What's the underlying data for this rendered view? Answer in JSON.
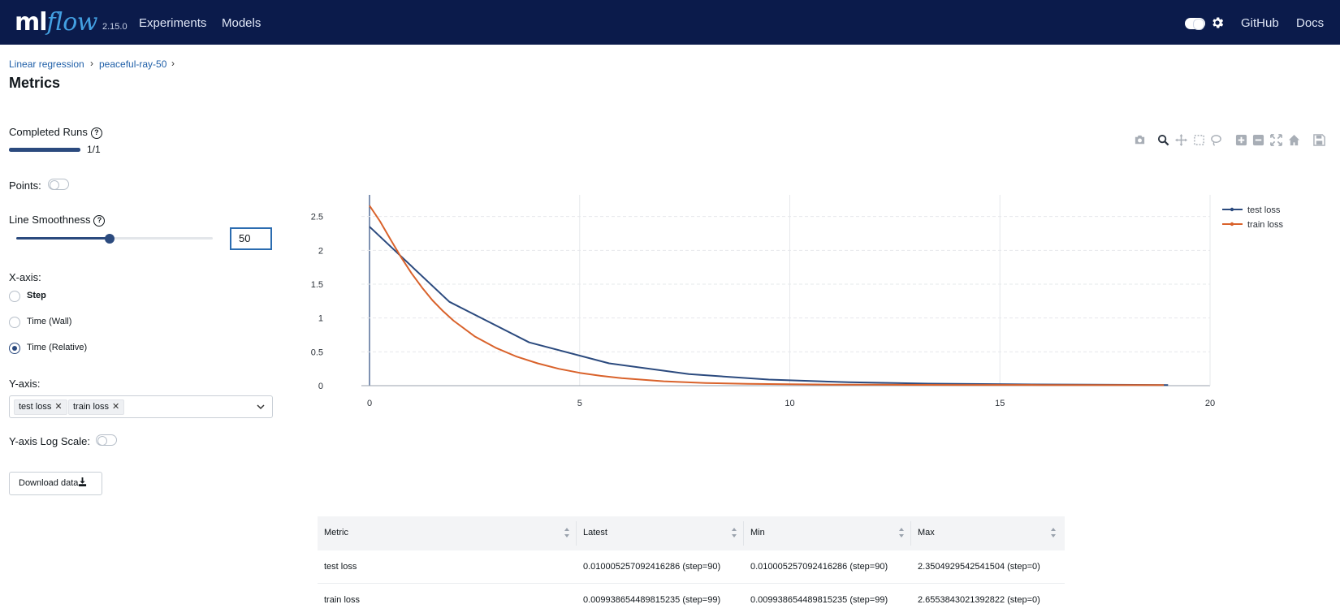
{
  "header": {
    "logo_left": "ml",
    "logo_right": "flow",
    "version": "2.15.0",
    "nav": [
      "Experiments",
      "Models"
    ],
    "right_links": [
      "GitHub",
      "Docs"
    ],
    "theme_toggle_icon": "toggle-icon",
    "settings_icon": "gear-icon"
  },
  "breadcrumb": {
    "items": [
      "Linear regression",
      "peaceful-ray-50"
    ],
    "separator": "›"
  },
  "page": {
    "title": "Metrics"
  },
  "controls": {
    "completed_runs_label": "Completed Runs",
    "completed_runs_text": "1/1",
    "completed_runs_fraction": 1.0,
    "points_label": "Points:",
    "points_on": false,
    "smoothness_label": "Line Smoothness",
    "smoothness_value": "50",
    "smoothness_level": 0.5,
    "xaxis_label": "X-axis:",
    "xaxis_options": [
      "Step",
      "Time (Wall)",
      "Time (Relative)"
    ],
    "xaxis_selected": "Time (Relative)",
    "yaxis_label": "Y-axis:",
    "yaxis_selected": [
      "test loss",
      "train loss"
    ],
    "yaxis_log_label": "Y-axis Log Scale:",
    "yaxis_log_on": false,
    "download_label": "Download data",
    "download_icon": "download-icon"
  },
  "plot_toolbar": [
    "camera-icon",
    "zoom-icon",
    "pan-icon",
    "box-select-icon",
    "lasso-icon",
    "zoom-in-icon",
    "zoom-out-icon",
    "autoscale-icon",
    "home-icon",
    "save-icon"
  ],
  "chart_data": {
    "type": "line",
    "xlim": [
      0,
      20
    ],
    "ylim": [
      0,
      2.7
    ],
    "x_ticks": [
      "0",
      "5",
      "10",
      "15",
      "20"
    ],
    "y_ticks": [
      "0",
      "0.5",
      "1",
      "1.5",
      "2",
      "2.5"
    ],
    "grid": true,
    "legend_position": "top-right",
    "series": [
      {
        "name": "test loss",
        "color": "#2b4a7e",
        "x": [
          0,
          1.9,
          3.8,
          5.7,
          7.6,
          9.5,
          11.4,
          13.3,
          15.2,
          17.1,
          19.0
        ],
        "y": [
          2.35,
          1.24,
          0.64,
          0.33,
          0.17,
          0.09,
          0.05,
          0.03,
          0.02,
          0.015,
          0.01
        ]
      },
      {
        "name": "train loss",
        "color": "#d9622b",
        "x": [
          0,
          0.25,
          0.5,
          0.75,
          1.0,
          1.25,
          1.5,
          1.75,
          2.0,
          2.5,
          3.0,
          3.5,
          4.0,
          4.5,
          5.0,
          5.5,
          6.0,
          7.0,
          8.0,
          9.0,
          10.0,
          11.0,
          12.0,
          13.0,
          14.0,
          15.0,
          16.0,
          17.0,
          18.0,
          18.9
        ],
        "y": [
          2.66,
          2.43,
          2.16,
          1.9,
          1.66,
          1.45,
          1.26,
          1.1,
          0.96,
          0.73,
          0.56,
          0.43,
          0.33,
          0.25,
          0.19,
          0.145,
          0.11,
          0.065,
          0.04,
          0.028,
          0.02,
          0.016,
          0.014,
          0.012,
          0.011,
          0.0105,
          0.01,
          0.01,
          0.0099,
          0.0099
        ]
      }
    ]
  },
  "table": {
    "columns": [
      "Metric",
      "Latest",
      "Min",
      "Max"
    ],
    "rows": [
      [
        "test loss",
        "0.010005257092416286 (step=90)",
        "0.010005257092416286 (step=90)",
        "2.3504929542541504 (step=0)"
      ],
      [
        "train loss",
        "0.009938654489815235 (step=99)",
        "0.009938654489815235 (step=99)",
        "2.6553843021392822 (step=0)"
      ]
    ]
  }
}
